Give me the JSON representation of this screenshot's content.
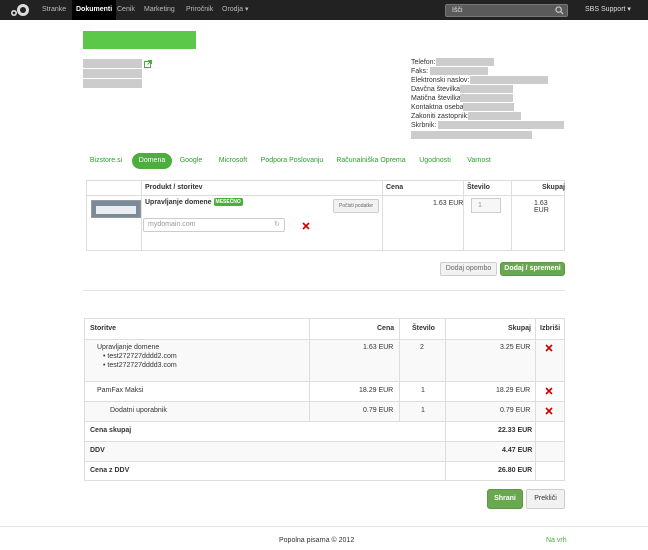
{
  "nav": {
    "items": [
      "Stranke",
      "Dokumenti",
      "Cenik",
      "Marketing",
      "Priročnik",
      "Orodja"
    ],
    "search_placeholder": "Išči",
    "user": "SBS Support"
  },
  "contact_labels": [
    "Telefon:",
    "Faks:",
    "Elektronski naslov:",
    "Davčna številka:",
    "Matična številka:",
    "Kontaktna oseba:",
    "Zakoniti zastopnik:",
    "Skrbnik:"
  ],
  "categories": [
    "Bizstore.si",
    "Domena",
    "Google",
    "Microsoft",
    "Podpora Poslovanju",
    "Računalniška Oprema",
    "Ugodnosti",
    "Varnost"
  ],
  "product_table": {
    "headers": {
      "product": "Produkt / storitev",
      "price": "Cena",
      "qty": "Število",
      "total": "Skupaj"
    },
    "name": "Upravljanje domene",
    "badge": "MESEČNO",
    "clear_button": "Počisti podatke",
    "domain_placeholder": "mydomain.com",
    "price": "1.63 EUR",
    "qty": "1",
    "total": "1.63 EUR"
  },
  "actions": {
    "note": "Dodaj opombo",
    "add_save": "Dodaj / spremeni"
  },
  "cart": {
    "headers": {
      "service": "Storitve",
      "price": "Cena",
      "qty": "Število",
      "total": "Skupaj",
      "delete": "Izbriši"
    },
    "rows": [
      {
        "name": "Upravljanje domene",
        "subitems": [
          "test272727dddd2.com",
          "test272727dddd3.com"
        ],
        "price": "1.63 EUR",
        "qty": "2",
        "total": "3.25 EUR"
      },
      {
        "name": "PamFax Maksi",
        "price": "18.29 EUR",
        "qty": "1",
        "total": "18.29 EUR"
      },
      {
        "name": "Dodatni uporabnik",
        "price": "0.79 EUR",
        "qty": "1",
        "total": "0.79 EUR"
      }
    ],
    "totals": [
      {
        "label": "Cena skupaj",
        "value": "22.33 EUR"
      },
      {
        "label": "DDV",
        "value": "4.47 EUR"
      },
      {
        "label": "Cena z DDV",
        "value": "26.80 EUR"
      }
    ]
  },
  "buttons": {
    "save": "Shrani",
    "cancel": "Prekliči"
  },
  "footer": {
    "copyright": "Popolna pisarna © 2012",
    "back_to_top": "Na vrh"
  },
  "colors": {
    "accent": "#4cae3c",
    "delete": "#cc0000",
    "nav_bg": "#222222"
  }
}
